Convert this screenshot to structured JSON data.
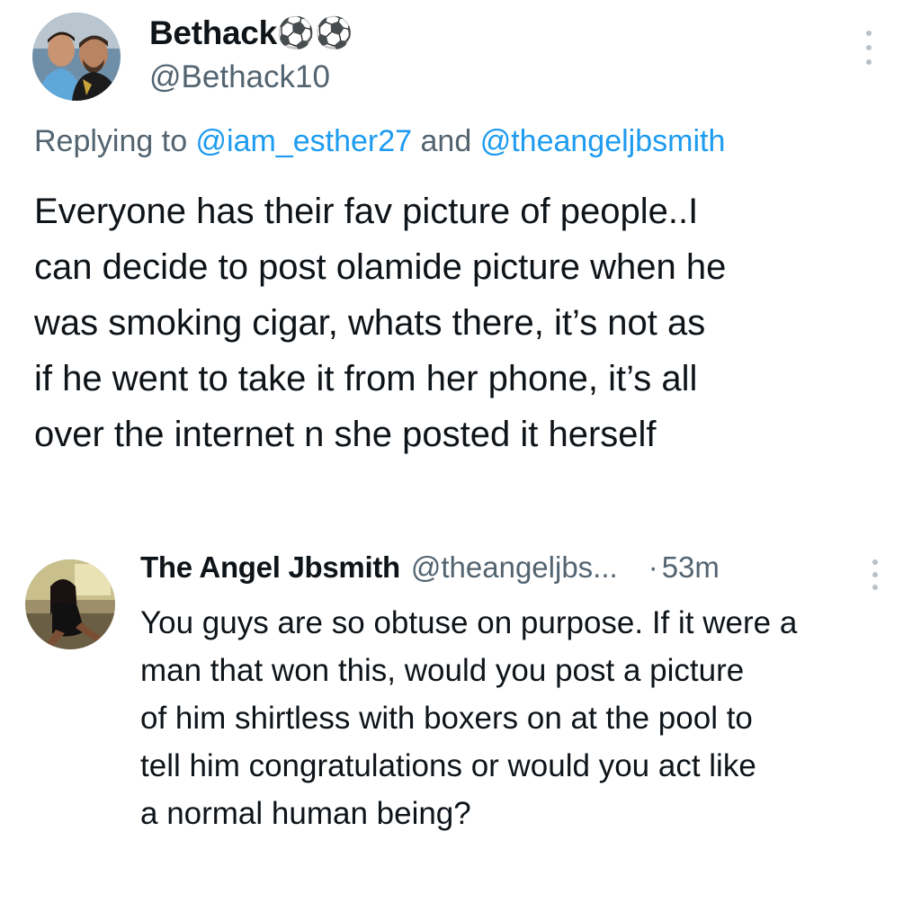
{
  "main_tweet": {
    "author": {
      "display_name": "Bethack",
      "name_emoji": "⚽⚽",
      "handle": "@Bethack10"
    },
    "reply_prefix": "Replying to ",
    "reply_mention_1": "@iam_esther27",
    "reply_conjunction": " and ",
    "reply_mention_2": "@theangeljbsmith",
    "text": "Everyone has their fav picture of people..I\ncan decide to post olamide picture when he\nwas smoking cigar, whats there, it’s not as\nif he went to take it from her phone, it’s all\nover the internet n she posted it herself",
    "more_icon": "more-vertical-icon"
  },
  "reply_tweet": {
    "author": {
      "display_name": "The Angel Jbsmith",
      "handle": "@theangeljbs..."
    },
    "separator": "·",
    "time": "53m",
    "text": "You guys are so obtuse on purpose. If it were a\nman that won this, would you post a picture\nof him shirtless with boxers on at the pool to\ntell him congratulations or would you act like\na normal human being?",
    "more_icon": "more-vertical-icon"
  },
  "colors": {
    "text_primary": "#0f1419",
    "text_secondary": "#536471",
    "link": "#1d9bf0",
    "background": "#ffffff"
  }
}
